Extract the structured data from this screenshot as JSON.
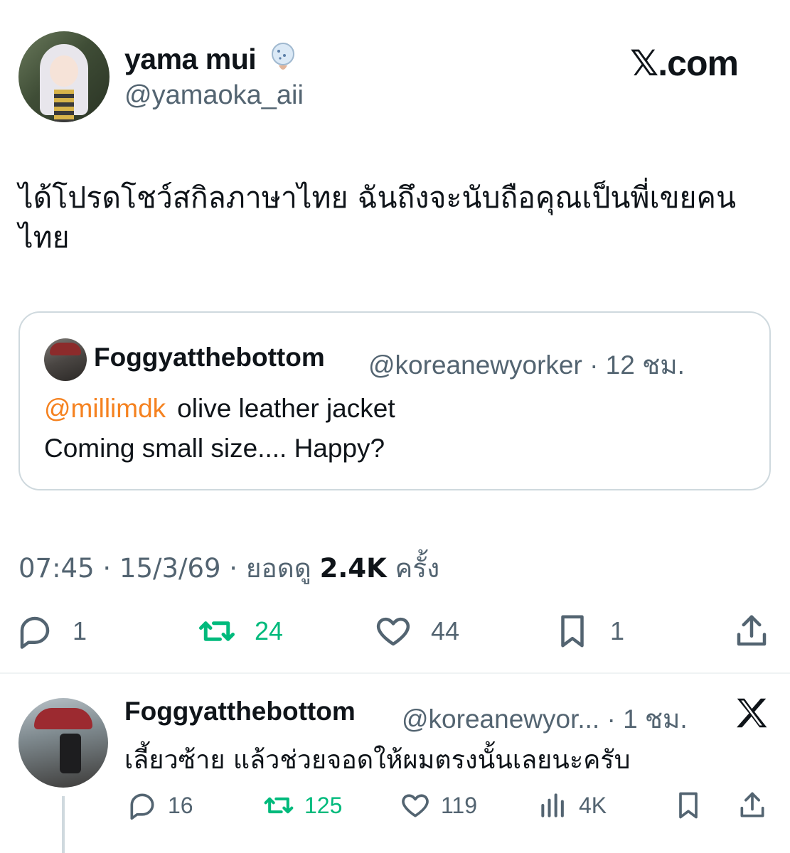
{
  "post": {
    "author_name": "yama mui",
    "author_handle": "@yamaoka_aii",
    "brand": "𝕏.com",
    "text": "ได้โปรดโชว์สกิลภาษาไทย ฉันถึงจะนับถือคุณเป็นพี่เขยคนไทย",
    "quote": {
      "author_name": "Foggyatthebottom",
      "author_handle": "@koreanewyorker · 12 ชม.",
      "mention": "@millimdk",
      "line1": "olive leather jacket",
      "line2": "Coming small size.... Happy?"
    },
    "meta": {
      "time_date": "07:45 · 15/3/69 · ยอดดู ",
      "views": "2.4K",
      "views_suffix": " ครั้ง"
    },
    "actions": {
      "replies": "1",
      "reposts": "24",
      "likes": "44",
      "bookmarks": "1"
    }
  },
  "reply": {
    "author_name": "Foggyatthebottom",
    "author_handle": "@koreanewyor... · 1 ชม.",
    "text": "เลี้ยวซ้าย แล้วช่วยจอดให้ผมตรงนั้นเลยนะครับ",
    "actions": {
      "replies": "16",
      "reposts": "125",
      "likes": "119",
      "views": "4K"
    }
  },
  "colors": {
    "accent_mention": "#f58220",
    "repost_green": "#00ba7c",
    "secondary_text": "#536471"
  }
}
